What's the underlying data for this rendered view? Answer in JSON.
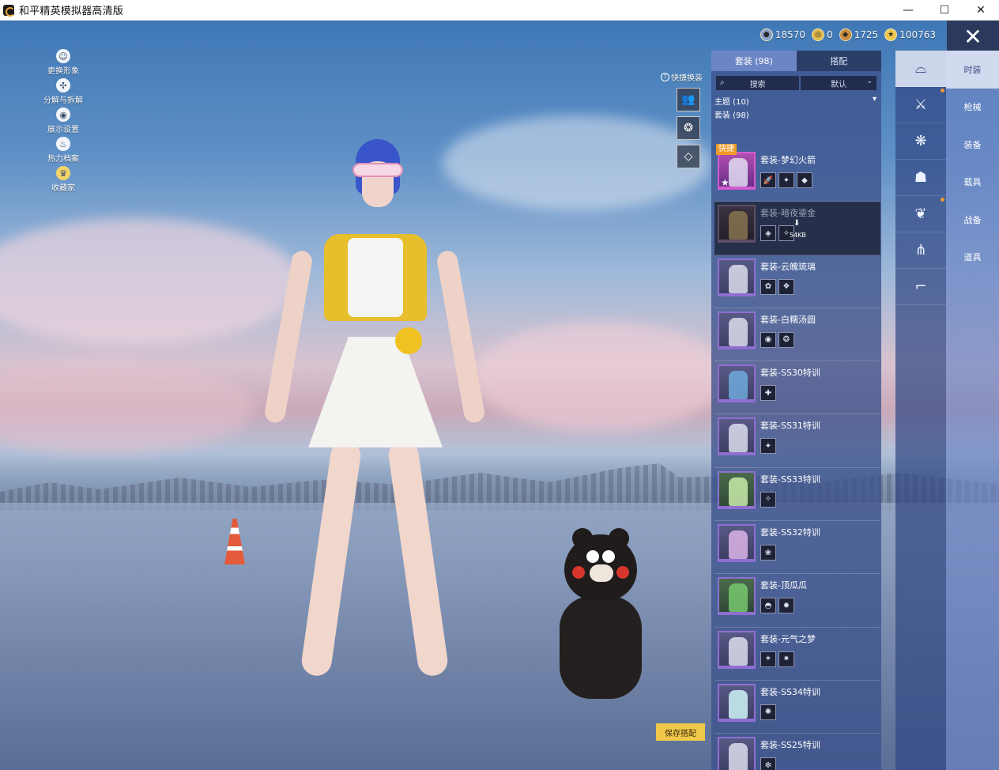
{
  "window": {
    "title": "和平精英模拟器高清版",
    "controls": {
      "minimize": "—",
      "maximize": "☐",
      "close": "✕"
    }
  },
  "left_menu": [
    {
      "label": "更换形象",
      "icon": "person-icon"
    },
    {
      "label": "分解与拆解",
      "icon": "puzzle-icon"
    },
    {
      "label": "展示设置",
      "icon": "eye-icon"
    },
    {
      "label": "热力档案",
      "icon": "flame-icon"
    },
    {
      "label": "收藏家",
      "icon": "collector-badge-icon"
    }
  ],
  "currency": [
    {
      "icon": "silver-coin-icon",
      "value": "18570",
      "color": "#8aa0c9"
    },
    {
      "icon": "gold-coin-icon",
      "value": "0",
      "color": "#e1b949"
    },
    {
      "icon": "bronze-coin-icon",
      "value": "1725",
      "color": "#c98b3d"
    },
    {
      "icon": "star-coin-icon",
      "value": "100763",
      "color": "#ecc94e"
    }
  ],
  "quick_change": {
    "title": "快捷换装",
    "slots": [
      "outfit-slot-icon",
      "emblem-slot-icon",
      "diamond-slot-icon"
    ]
  },
  "panel": {
    "tabs": [
      {
        "label": "套装 (98)",
        "active": true
      },
      {
        "label": "搭配",
        "active": false
      }
    ],
    "search_label": "搜索",
    "sort_label": "默认",
    "theme_label": "主题 (10)",
    "count_label": "套装 (98)",
    "fast_badge": "快捷",
    "download_size": "54KB",
    "outfits": [
      {
        "name": "套装-梦幻火箭",
        "pieces": [
          "🚀",
          "✦",
          "◆"
        ],
        "variant": "pink",
        "selected": false
      },
      {
        "name": "套装-暗夜鎏金",
        "pieces": [
          "◈",
          "✧"
        ],
        "variant": "dark",
        "selected": true
      },
      {
        "name": "套装-云魄琉璃",
        "pieces": [
          "✿",
          "❖"
        ],
        "variant": "default",
        "selected": false
      },
      {
        "name": "套装-白糯汤圆",
        "pieces": [
          "◉",
          "❂"
        ],
        "variant": "default",
        "selected": false
      },
      {
        "name": "套装-SS30特训",
        "pieces": [
          "✚"
        ],
        "variant": "default",
        "selected": false
      },
      {
        "name": "套装-SS31特训",
        "pieces": [
          "✦"
        ],
        "variant": "default",
        "selected": false
      },
      {
        "name": "套装-SS33特训",
        "pieces": [
          "✧"
        ],
        "variant": "green",
        "selected": false
      },
      {
        "name": "套装-SS32特训",
        "pieces": [
          "❀"
        ],
        "variant": "default",
        "selected": false
      },
      {
        "name": "套装-顶瓜瓜",
        "pieces": [
          "◓",
          "✹"
        ],
        "variant": "green",
        "selected": false
      },
      {
        "name": "套装-元气之梦",
        "pieces": [
          "✶",
          "✷"
        ],
        "variant": "default",
        "selected": false
      },
      {
        "name": "套装-SS34特训",
        "pieces": [
          "✺"
        ],
        "variant": "default",
        "selected": false
      },
      {
        "name": "套装-SS25特训",
        "pieces": [
          "✻"
        ],
        "variant": "default",
        "selected": false
      }
    ]
  },
  "categories": [
    {
      "label": "时装",
      "icon": "hat-icon",
      "active": true,
      "dot": false
    },
    {
      "label": "枪械",
      "icon": "gun-icon",
      "active": false,
      "dot": true
    },
    {
      "label": "装备",
      "icon": "backpack-icon",
      "active": false,
      "dot": false
    },
    {
      "label": "载具",
      "icon": "mask-icon",
      "active": false,
      "dot": false
    },
    {
      "label": "战备",
      "icon": "vest-icon",
      "active": false,
      "dot": true
    },
    {
      "label": "道具",
      "icon": "pants-icon",
      "active": false,
      "dot": false
    },
    {
      "label": "",
      "icon": "shoes-icon",
      "active": false,
      "dot": false
    }
  ],
  "save_button": "保存搭配",
  "colors": {
    "accent_orange": "#f09a2a",
    "save_yellow": "#f0c84b",
    "panel_blue": "#3c528c"
  }
}
